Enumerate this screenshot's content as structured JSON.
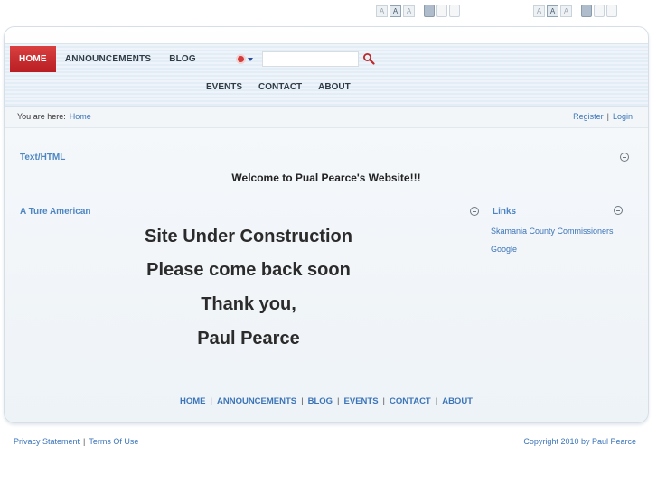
{
  "toolbar": {
    "font_buttons": [
      "A",
      "A",
      "A"
    ]
  },
  "nav": {
    "primary": [
      {
        "label": "HOME",
        "active": true
      },
      {
        "label": "ANNOUNCEMENTS",
        "active": false
      },
      {
        "label": "BLOG",
        "active": false
      }
    ],
    "secondary": [
      {
        "label": "EVENTS"
      },
      {
        "label": "CONTACT"
      },
      {
        "label": "ABOUT"
      }
    ]
  },
  "search": {
    "value": "",
    "icon": "search-icon"
  },
  "breadcrumb": {
    "prefix": "You are here:",
    "current": "Home"
  },
  "account": {
    "register": "Register",
    "separator": "|",
    "login": "Login"
  },
  "modules": {
    "text_html": {
      "title": "Text/HTML",
      "content": "Welcome to Pual Pearce's Website!!!"
    },
    "main": {
      "title": "A Ture American",
      "lines": [
        "Site Under Construction",
        "Please come back soon",
        "Thank you,",
        "Paul Pearce"
      ]
    },
    "links": {
      "title": "Links",
      "items": [
        "Skamania County Commissioners",
        "Google"
      ]
    }
  },
  "footer_nav": [
    "HOME",
    "ANNOUNCEMENTS",
    "BLOG",
    "EVENTS",
    "CONTACT",
    "ABOUT"
  ],
  "footer_sep": "|",
  "bottom": {
    "privacy": "Privacy Statement",
    "separator": "|",
    "terms": "Terms Of Use",
    "copyright": "Copyright 2010 by Paul Pearce"
  },
  "colors": {
    "accent": "#c62828",
    "link": "#3b74b8",
    "module_title": "#4d86c3"
  }
}
